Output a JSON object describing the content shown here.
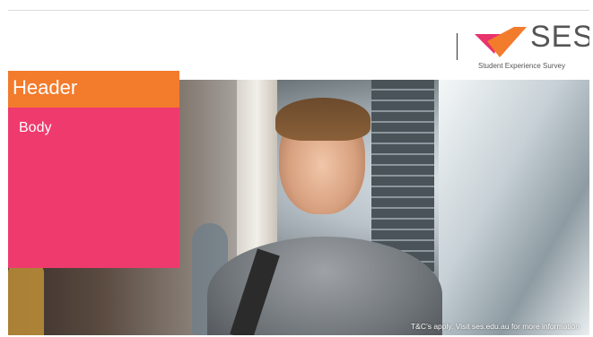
{
  "slide": {
    "header_label": "Header",
    "body_label": "Body",
    "footer_note": "T&C’s apply. Visit ses.edu.au for more information"
  },
  "logo": {
    "title": "SES",
    "subtitle": "Student Experience Survey",
    "icon_name": "ses-logo-mark-icon"
  },
  "colors": {
    "header_orange": "#f37b2c",
    "body_pink": "#ef3a6e",
    "logo_orange": "#f37b2c",
    "logo_pink": "#e8336d"
  },
  "photo": {
    "description_icon": "student-photo"
  }
}
